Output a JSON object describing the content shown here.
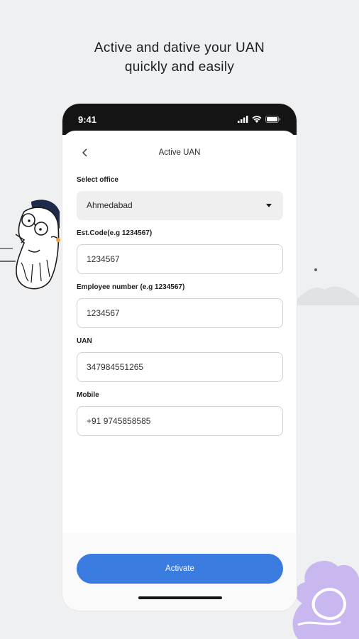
{
  "headline": {
    "line1": "Active and dative your  UAN",
    "line2": "quickly and easily"
  },
  "status_bar": {
    "time": "9:41",
    "icons": [
      "signal-icon",
      "wifi-icon",
      "battery-icon"
    ]
  },
  "nav": {
    "back_icon": "chevron-left-icon",
    "title": "Active UAN"
  },
  "form": {
    "office": {
      "label": "Select office",
      "value": "Ahmedabad"
    },
    "est_code": {
      "label": "Est.Code(e.g 1234567)",
      "value": "1234567"
    },
    "employee_number": {
      "label": "Employee number (e.g 1234567)",
      "value": "1234567"
    },
    "uan": {
      "label": "UAN",
      "value": "347984551265"
    },
    "mobile": {
      "label": "Mobile",
      "value": "+91 9745858585"
    }
  },
  "activate_button": {
    "label": "Activate"
  },
  "colors": {
    "background": "#eef0f2",
    "accent": "#3a7be0",
    "status_bar": "#141414",
    "deco_purple": "#c9b8f0"
  }
}
